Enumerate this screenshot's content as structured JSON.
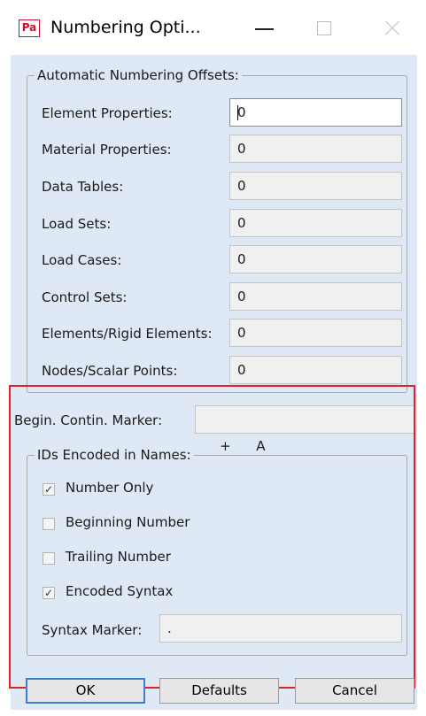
{
  "window": {
    "title": "Numbering Opti...",
    "icon_text": "Pa",
    "icon_color": "#c8102e"
  },
  "offsets_group": {
    "title": "Automatic Numbering Offsets:",
    "rows": [
      {
        "label": "Element Properties:",
        "value": "0",
        "focused": true
      },
      {
        "label": "Material Properties:",
        "value": "0"
      },
      {
        "label": "Data Tables:",
        "value": "0"
      },
      {
        "label": "Load Sets:",
        "value": "0"
      },
      {
        "label": "Load Cases:",
        "value": "0"
      },
      {
        "label": "Control Sets:",
        "value": "0"
      },
      {
        "label": "Elements/Rigid Elements:",
        "value": "0"
      },
      {
        "label": "Nodes/Scalar Points:",
        "value": "0"
      }
    ]
  },
  "contin_marker": {
    "label": "Begin. Contin. Marker:",
    "value": "+      A"
  },
  "ids_group": {
    "title": "IDs Encoded in Names:",
    "options": [
      {
        "label": "Number Only",
        "checked": true
      },
      {
        "label": "Beginning Number",
        "checked": false
      },
      {
        "label": "Trailing Number",
        "checked": false
      },
      {
        "label": "Encoded Syntax",
        "checked": true
      }
    ],
    "syntax_marker": {
      "label": "Syntax Marker:",
      "value": "."
    }
  },
  "buttons": {
    "ok": "OK",
    "defaults": "Defaults",
    "cancel": "Cancel"
  },
  "colors": {
    "client_bg": "#dfe8f5",
    "highlight": "#e0202a",
    "default_button_border": "#3a7fd4"
  }
}
